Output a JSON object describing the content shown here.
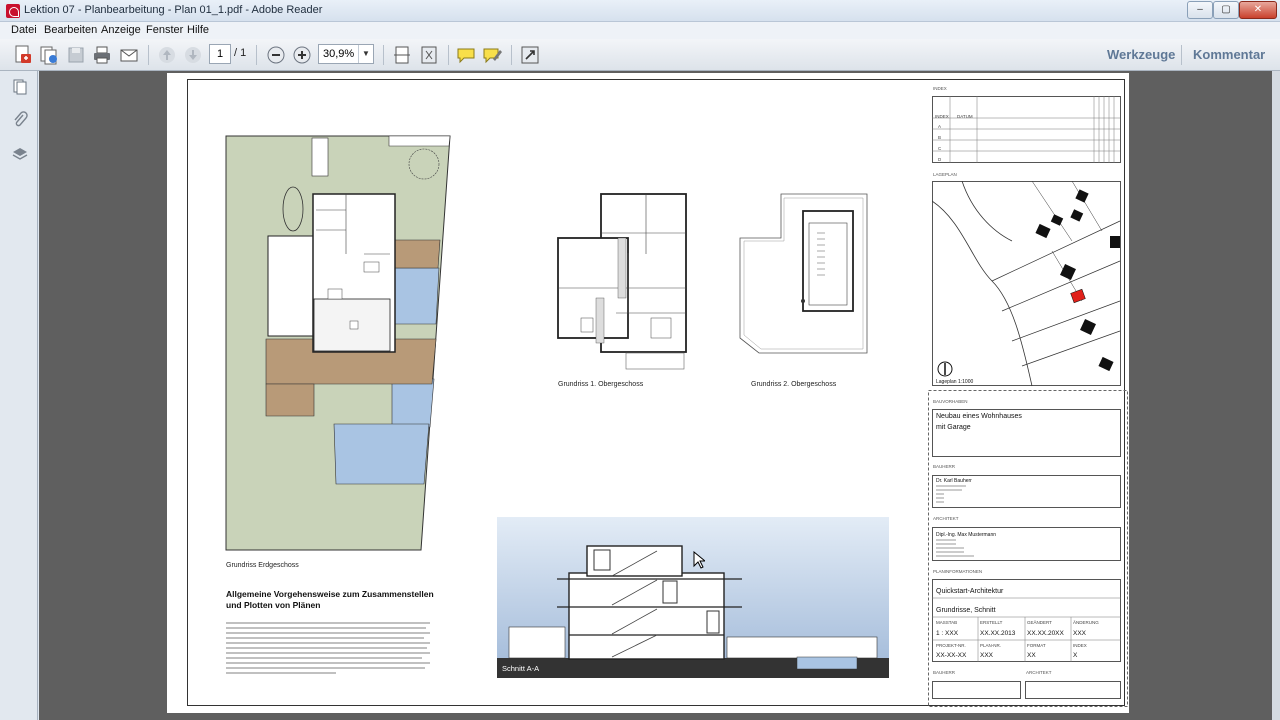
{
  "window": {
    "title": "Lektion 07 - Planbearbeitung - Plan 01_1.pdf - Adobe Reader",
    "minimize": "–",
    "maximize": "▢",
    "close": "✕"
  },
  "menu": [
    "Datei",
    "Bearbeiten",
    "Anzeige",
    "Fenster",
    "Hilfe"
  ],
  "toolbar": {
    "page_current": "1",
    "page_total": "/ 1",
    "zoom": "30,9%",
    "tools_label": "Werkzeuge",
    "comment_label": "Kommentar",
    "icons": [
      "create-pdf-icon",
      "combine-icon",
      "save-icon",
      "print-icon",
      "email-icon",
      "prev-page-icon",
      "next-page-icon",
      "zoom-out-icon",
      "zoom-in-icon",
      "fit-page-icon",
      "fit-width-icon",
      "comment-icon",
      "highlight-icon",
      "fullscreen-icon"
    ]
  },
  "sidebar": {
    "icons": [
      "pages-icon",
      "attachments-icon",
      "layers-icon"
    ]
  },
  "plan": {
    "captions": {
      "ground_floor": "Grundriss Erdgeschoss",
      "first_floor": "Grundriss 1. Obergeschoss",
      "second_floor": "Grundriss 2. Obergeschoss",
      "section": "Schnitt A-A"
    },
    "heading": "Allgemeine Vorgehensweise zum Zusammenstellen und Plotten von Plänen",
    "titleblock": {
      "index_label": "INDEX",
      "index_col_index": "INDEX",
      "index_col_date": "DATUM",
      "index_rows": [
        "A",
        "B",
        "C",
        "D"
      ],
      "lageplan_label": "LAGEPLAN",
      "lageplan_caption": "Lageplan 1:1000",
      "bauvorhaben_label": "BAUVORHABEN",
      "bauvorhaben_line1": "Neubau eines Wohnhauses",
      "bauvorhaben_line2": "mit Garage",
      "bauherr_label": "BAUHERR",
      "bauherr_name": "Dr. Karl Bauherr",
      "architekt_label": "ARCHITEKT",
      "architekt_name": "Dipl.-Ing. Max Mustermann",
      "planinfo_label": "PLANINFORMATIONEN",
      "project": "Quickstart-Architektur",
      "plan_content": "Grundrisse, Schnitt",
      "grid_labels": [
        "MASSTAB",
        "ERSTELLT",
        "GEÄNDERT",
        "ÄNDERUNG",
        "PROJEKT-NR.",
        "PLAN-NR.",
        "FORMAT",
        "INDEX"
      ],
      "grid_values": [
        "1 : XXX",
        "XX.XX.2013",
        "XX.XX.20XX",
        "XXX",
        "XX-XX-XX",
        "XXX",
        "XX",
        "X"
      ],
      "sign_bauherr": "BAUHERR",
      "sign_architekt": "ARCHITEKT"
    }
  },
  "colors": {
    "doc_bg": "#5f5f5f",
    "terrain": "#c9d3b9",
    "water": "#a9c4e3",
    "deck": "#b89a78",
    "sky_top": "#e3ecf6",
    "sky_bottom": "#9fb8d8",
    "marker_red": "#e0201a"
  }
}
